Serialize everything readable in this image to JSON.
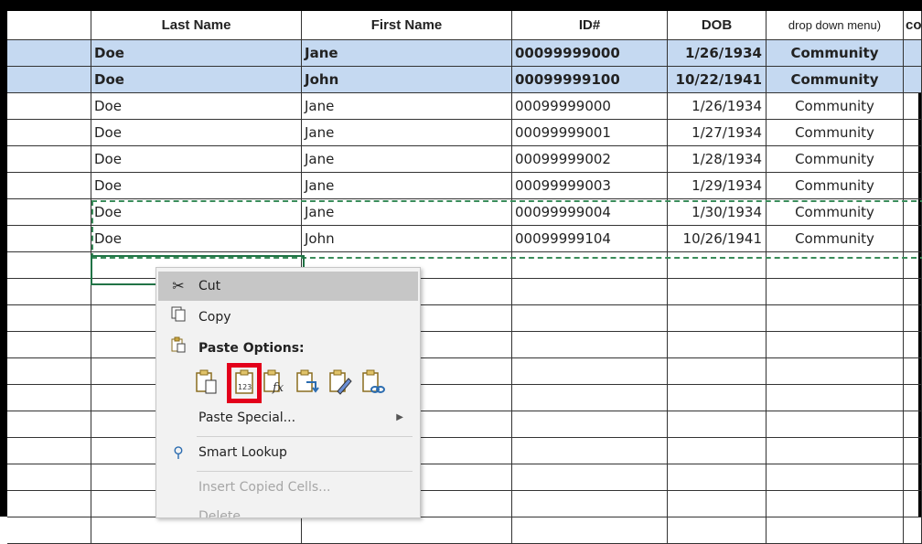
{
  "columns": [
    "Last Name",
    "First Name",
    "ID#",
    "DOB",
    "drop down menu)",
    "co"
  ],
  "rows": [
    {
      "last": "Doe",
      "first": "Jane",
      "id": "00099999000",
      "dob": "1/26/1934",
      "type": "Community",
      "highlight": true
    },
    {
      "last": "Doe",
      "first": "John",
      "id": "00099999100",
      "dob": "10/22/1941",
      "type": "Community",
      "highlight": true
    },
    {
      "last": "Doe",
      "first": "Jane",
      "id": "00099999000",
      "dob": "1/26/1934",
      "type": "Community"
    },
    {
      "last": "Doe",
      "first": "Jane",
      "id": "00099999001",
      "dob": "1/27/1934",
      "type": "Community"
    },
    {
      "last": "Doe",
      "first": "Jane",
      "id": "00099999002",
      "dob": "1/28/1934",
      "type": "Community"
    },
    {
      "last": "Doe",
      "first": "Jane",
      "id": "00099999003",
      "dob": "1/29/1934",
      "type": "Community"
    },
    {
      "last": "Doe",
      "first": "Jane",
      "id": "00099999004",
      "dob": "1/30/1934",
      "type": "Community"
    },
    {
      "last": "Doe",
      "first": "John",
      "id": "00099999104",
      "dob": "10/26/1941",
      "type": "Community"
    }
  ],
  "context_menu": {
    "cut": "Cut",
    "copy": "Copy",
    "paste_options": "Paste Options:",
    "paste_special": "Paste Special...",
    "smart_lookup": "Smart Lookup",
    "insert_copied_cells": "Insert Copied Cells...",
    "delete": "Delete",
    "paste_buttons": [
      "paste-icon",
      "paste-values-icon",
      "paste-formulas-icon",
      "paste-transpose-icon",
      "paste-formatting-icon",
      "paste-link-icon"
    ],
    "paste_values_label": "123",
    "selected_color": "#e3001b"
  },
  "colors": {
    "row_highlight": "#c5d9f1",
    "marquee": "#3a8c5a"
  }
}
